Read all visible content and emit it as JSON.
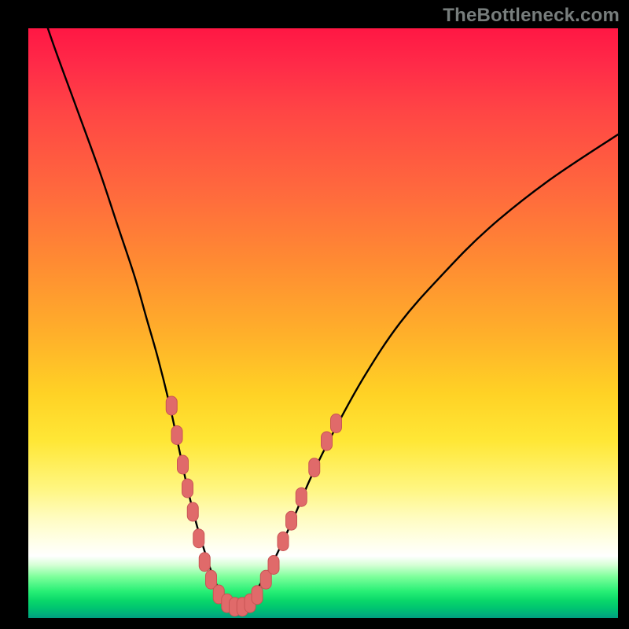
{
  "watermark": "TheBottleneck.com",
  "colors": {
    "page_bg": "#000000",
    "curve_stroke": "#000000",
    "marker_fill": "#e06a6a",
    "marker_stroke": "#c85454"
  },
  "chart_data": {
    "type": "line",
    "title": "",
    "xlabel": "",
    "ylabel": "",
    "xlim": [
      0,
      100
    ],
    "ylim": [
      0,
      100
    ],
    "grid": false,
    "legend": false,
    "background": "rainbow-gradient",
    "annotations": [],
    "series": [
      {
        "name": "bottleneck-curve",
        "x": [
          0,
          4,
          8,
          12,
          15,
          18,
          20,
          22,
          24,
          25.5,
          27,
          28.5,
          30,
          31,
          32,
          33,
          34,
          35,
          36,
          37,
          38,
          40,
          42,
          45,
          48,
          52,
          57,
          63,
          70,
          78,
          88,
          100
        ],
        "y": [
          110,
          98,
          87,
          76,
          67,
          58,
          51,
          44,
          36,
          29,
          22,
          16,
          11,
          8,
          5.5,
          3.8,
          2.6,
          2.0,
          2.0,
          2.6,
          3.8,
          6.8,
          10.5,
          17,
          24,
          32,
          41,
          50,
          58,
          66,
          74,
          82
        ]
      }
    ],
    "markers": {
      "name": "highlight-dots",
      "points": [
        {
          "x": 24.3,
          "y": 36
        },
        {
          "x": 25.2,
          "y": 31
        },
        {
          "x": 26.2,
          "y": 26
        },
        {
          "x": 27.0,
          "y": 22
        },
        {
          "x": 27.9,
          "y": 18
        },
        {
          "x": 28.9,
          "y": 13.5
        },
        {
          "x": 29.9,
          "y": 9.5
        },
        {
          "x": 31.0,
          "y": 6.5
        },
        {
          "x": 32.3,
          "y": 4.0
        },
        {
          "x": 33.7,
          "y": 2.5
        },
        {
          "x": 35.0,
          "y": 1.9
        },
        {
          "x": 36.3,
          "y": 1.9
        },
        {
          "x": 37.6,
          "y": 2.5
        },
        {
          "x": 38.8,
          "y": 3.9
        },
        {
          "x": 40.3,
          "y": 6.5
        },
        {
          "x": 41.6,
          "y": 9.0
        },
        {
          "x": 43.2,
          "y": 13.0
        },
        {
          "x": 44.6,
          "y": 16.5
        },
        {
          "x": 46.3,
          "y": 20.5
        },
        {
          "x": 48.5,
          "y": 25.5
        },
        {
          "x": 50.6,
          "y": 30.0
        },
        {
          "x": 52.2,
          "y": 33.0
        }
      ]
    }
  }
}
